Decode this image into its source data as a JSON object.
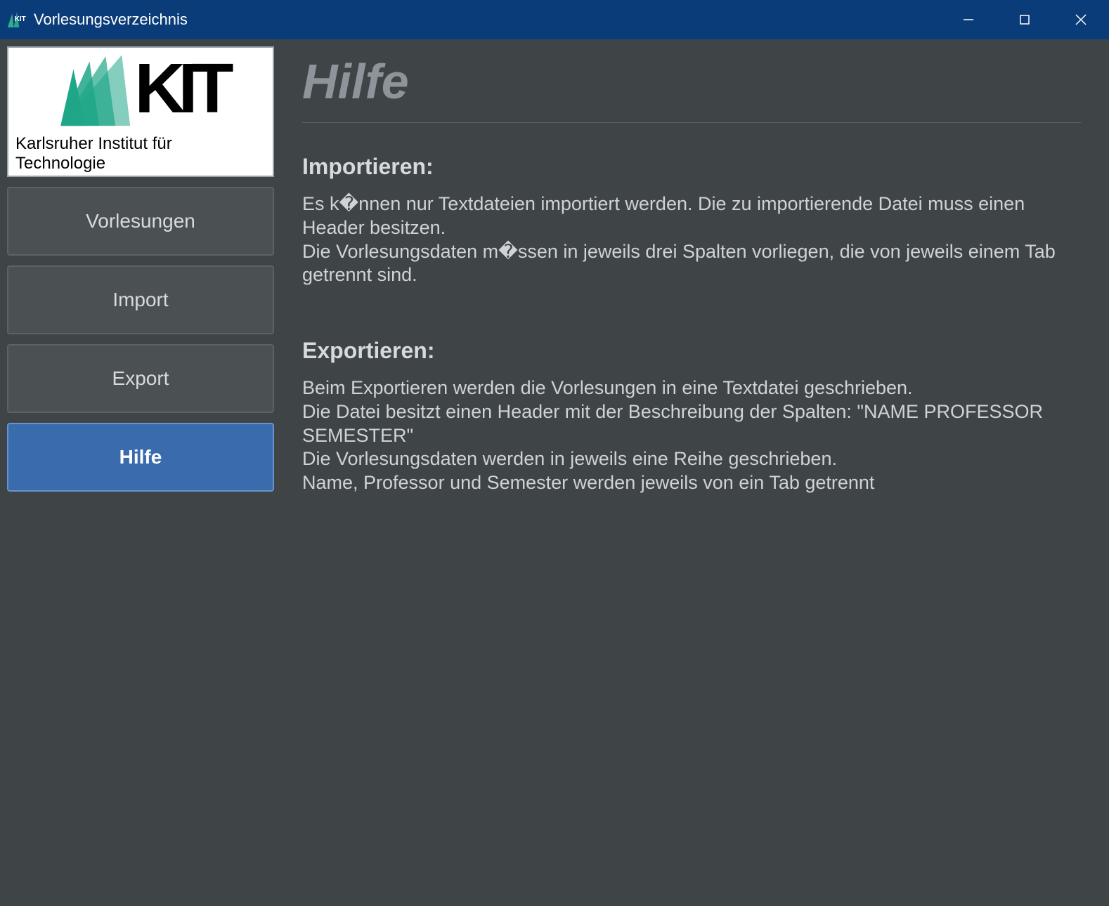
{
  "window": {
    "title": "Vorlesungsverzeichnis"
  },
  "logo": {
    "wordmark": "KIT",
    "subtitle": "Karlsruher Institut für Technologie"
  },
  "sidebar": {
    "items": [
      {
        "label": "Vorlesungen",
        "active": false
      },
      {
        "label": "Import",
        "active": false
      },
      {
        "label": "Export",
        "active": false
      },
      {
        "label": "Hilfe",
        "active": true
      }
    ]
  },
  "page": {
    "title": "Hilfe",
    "sections": [
      {
        "heading": "Importieren:",
        "lines": [
          "Es k�nnen nur Textdateien importiert werden. Die zu importierende Datei muss einen Header besitzen.",
          "Die Vorlesungsdaten m�ssen in jeweils drei Spalten vorliegen, die von jeweils einem Tab getrennt sind."
        ]
      },
      {
        "heading": "Exportieren:",
        "lines": [
          "Beim Exportieren werden die Vorlesungen in eine Textdatei geschrieben.",
          "Die Datei besitzt einen Header mit der Beschreibung der Spalten: \"NAME PROFESSOR SEMESTER\"",
          "Die Vorlesungsdaten werden in jeweils eine Reihe geschrieben.",
          "Name, Professor und Semester werden jeweils von ein Tab getrennt"
        ]
      }
    ]
  }
}
